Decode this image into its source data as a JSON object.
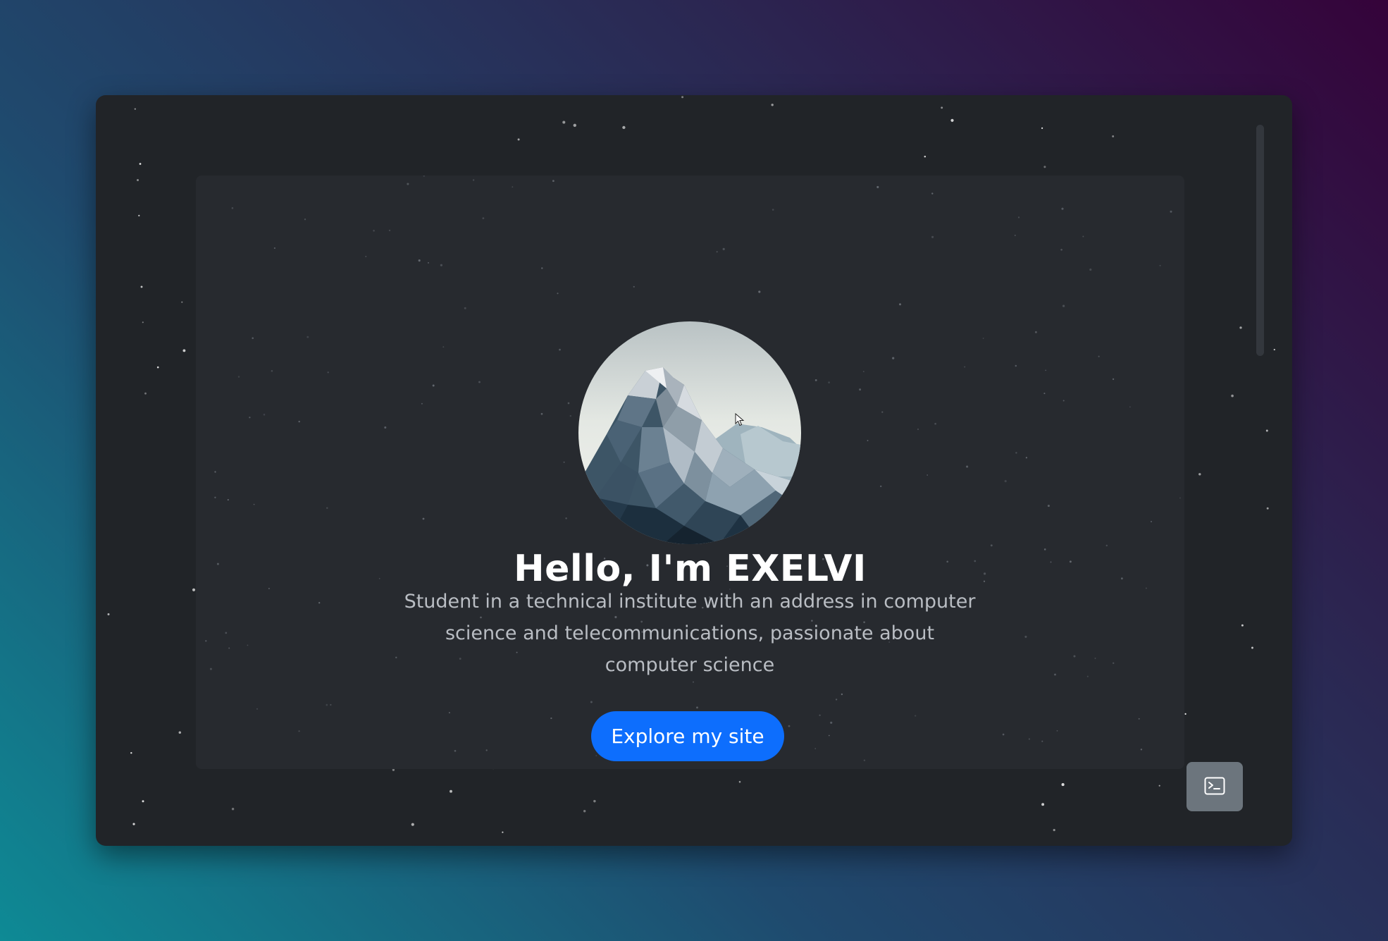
{
  "hero": {
    "avatar_alt": "low-poly mountain illustration",
    "title": "Hello, I'm EXELVI",
    "description": "Student in a technical institute with an address in computer science and telecommunications, passionate about computer science",
    "cta_label": "Explore my site"
  },
  "floating_button": {
    "icon": "terminal-icon"
  },
  "colors": {
    "accent": "#0d6efd",
    "window_bg": "#212428",
    "card_bg": "#272a2f",
    "terminal_button_bg": "#6c757d"
  }
}
